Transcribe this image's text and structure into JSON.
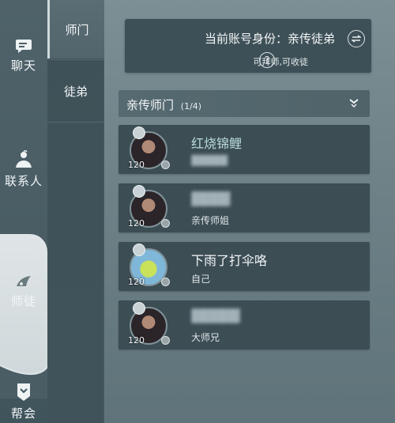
{
  "rail": {
    "items": [
      {
        "label": "聊天",
        "icon": "chat-bubble-icon"
      },
      {
        "label": "联系人",
        "icon": "contact-person-icon"
      },
      {
        "label": "师徒",
        "icon": "master-apprentice-icon"
      },
      {
        "label": "帮会",
        "icon": "guild-banner-icon"
      }
    ]
  },
  "tabs": [
    {
      "label": "师门"
    },
    {
      "label": "徒弟"
    }
  ],
  "info": {
    "identity_label": "当前账号身份：亲传徒弟",
    "permission_text": "可拜师,可收徒",
    "help_glyph": "?"
  },
  "section": {
    "title": "亲传师门",
    "count": "(1/4)"
  },
  "members": [
    {
      "name": "红烧锦鲤",
      "subtitle": "▓▓▓▓▓",
      "level": "120",
      "avatar": "char",
      "name_blurred": false,
      "sub_blurred": true
    },
    {
      "name": "▓▓▓▓",
      "subtitle": "亲传师姐",
      "level": "120",
      "avatar": "char",
      "name_blurred": true,
      "sub_blurred": false
    },
    {
      "name": "下雨了打伞咯",
      "subtitle": "自己",
      "level": "120",
      "avatar": "pet",
      "name_blurred": false,
      "sub_blurred": false
    },
    {
      "name": "▓▓▓▓▓",
      "subtitle": "大师兄",
      "level": "120",
      "avatar": "char",
      "name_blurred": true,
      "sub_blurred": false
    }
  ],
  "colors": {
    "accent_name": "#b9dcd9",
    "panel": "#3c4d54"
  }
}
